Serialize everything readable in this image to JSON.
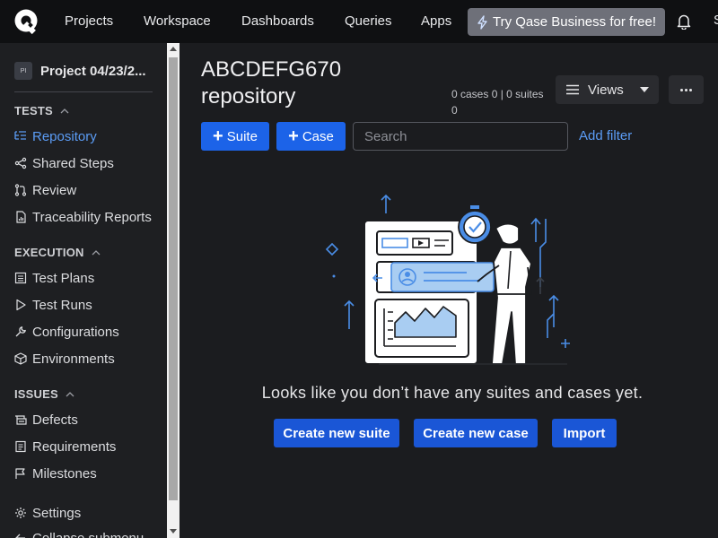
{
  "nav": {
    "items": [
      "Projects",
      "Workspace",
      "Dashboards",
      "Queries",
      "Apps"
    ],
    "promo_label": "Try Qase Business for free!",
    "edge_glyph": "S"
  },
  "sidebar": {
    "project_initials": "PI",
    "project_name": "Project 04/23/2...",
    "sections": {
      "tests": "TESTS",
      "execution": "EXECUTION",
      "issues": "ISSUES"
    },
    "tests_items": [
      {
        "label": "Repository",
        "icon": "list-tree-icon",
        "active": true
      },
      {
        "label": "Shared Steps",
        "icon": "share-icon"
      },
      {
        "label": "Review",
        "icon": "git-pull-request-icon"
      },
      {
        "label": "Traceability Reports",
        "icon": "report-icon"
      }
    ],
    "execution_items": [
      {
        "label": "Test Plans",
        "icon": "list-icon"
      },
      {
        "label": "Test Runs",
        "icon": "play-icon"
      },
      {
        "label": "Configurations",
        "icon": "wrench-icon"
      },
      {
        "label": "Environments",
        "icon": "cube-icon"
      }
    ],
    "issues_items": [
      {
        "label": "Defects",
        "icon": "bug-icon"
      },
      {
        "label": "Requirements",
        "icon": "document-icon"
      },
      {
        "label": "Milestones",
        "icon": "flag-icon"
      }
    ],
    "settings": "Settings",
    "collapse": "Collapse submenu"
  },
  "main": {
    "title": "ABCDEFG670 repository",
    "counts": "0 cases 0 | 0 suites 0",
    "views_label": "Views",
    "suite_btn": "Suite",
    "case_btn": "Case",
    "search_placeholder": "Search",
    "add_filter": "Add filter",
    "empty_message": "Looks like you don’t have any suites and cases yet.",
    "create_suite": "Create new suite",
    "create_case": "Create new case",
    "import": "Import"
  },
  "colors": {
    "accent": "#1c63e8",
    "link": "#5b9cf5",
    "background": "#1b1c1f",
    "sidebar": "#1e1f22",
    "topbar": "#0f1012"
  }
}
